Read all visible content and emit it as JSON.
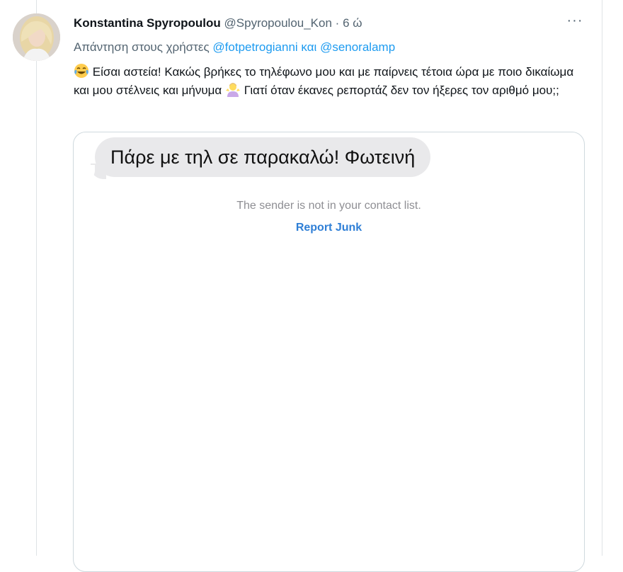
{
  "tweet": {
    "author_name": "Konstantina Spyropoulou",
    "handle": "@Spyropoulou_Kon",
    "separator": "·",
    "time_ago": "6 ώ",
    "more_icon": "more-horizontal-icon",
    "more_glyph": "···",
    "reply_prefix": "Απάντηση στους χρήστες",
    "reply_mention_1": "@fotpetrogianni",
    "reply_joiner": "και",
    "reply_mention_2": "@senoralamp",
    "emoji_1": "face-with-tears-of-joy-emoji",
    "text_part_1": "Είσαι αστεία! Κακώς βρήκες το τηλέφωνο μου και με παίρνεις τέτοια ώρα με ποιο δικαίωμα και μου στέλνεις και μήνυμα",
    "emoji_2": "person-shrugging-emoji",
    "text_part_2": "Γιατί όταν έκανες ρεπορτάζ δεν τον ήξερες τον αριθμό μου;;"
  },
  "media": {
    "message_bubble": "Πάρε με τηλ σε παρακαλώ! Φωτεινή",
    "notice": "The sender is not in your contact list.",
    "report_link": "Report Junk"
  },
  "colors": {
    "link": "#1d9bf0",
    "meta": "#536471",
    "bubble": "#e9e9eb",
    "report": "#2f7fd6",
    "card_border": "#cfd9de"
  }
}
